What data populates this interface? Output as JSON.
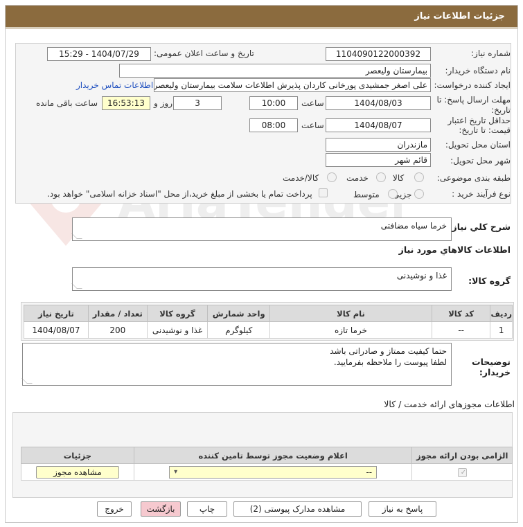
{
  "window": {
    "title": "جزئیات اطلاعات نیاز"
  },
  "info": {
    "need_number_label": "شماره نیاز:",
    "need_number": "1104090122000392",
    "announce_label": "تاریخ و ساعت اعلان عمومی:",
    "announce_value": "1404/07/29 - 15:29",
    "buyer_org_label": "نام دستگاه خریدار:",
    "buyer_org": "بیمارستان ولیعصر",
    "creator_label": "ایجاد کننده درخواست:",
    "creator": "علی اصغر جمشیدی پورخانی کاردان پذیرش اطلاعات سلامت بیمارستان ولیعصر",
    "contact_link": "اطلاعات تماس خریدار",
    "deadline_label_1": "مهلت ارسال پاسخ: تا",
    "deadline_label_2": "تاریخ:",
    "deadline_date": "1404/08/03",
    "time_label": "ساعت",
    "deadline_time": "10:00",
    "days_count": "3",
    "days_and_label": "روز و",
    "remaining_time": "16:53:13",
    "remaining_label": "ساعت باقی مانده",
    "validity_label_1": "حداقل تاریخ اعتبار",
    "validity_label_2": "قیمت: تا تاریخ:",
    "validity_date": "1404/08/07",
    "validity_time": "08:00",
    "province_label": "استان محل تحویل:",
    "province": "مازندران",
    "city_label": "شهر محل تحویل:",
    "city": "قائم شهر",
    "category_label": "طبقه بندی موضوعی:",
    "category_options": [
      "کالا",
      "خدمت",
      "کالا/خدمت"
    ],
    "process_label": "نوع فرآیند خرید :",
    "process_options": [
      "جزیی",
      "متوسط"
    ],
    "payment_note": "پرداخت تمام یا بخشی از مبلغ خرید،از محل \"اسناد خزانه اسلامی\" خواهد بود."
  },
  "description": {
    "label": "شرح كلي نياز:",
    "value": "خرما سیاه مضافتی"
  },
  "goods": {
    "section_title": "اطلاعات كالاهاي مورد نياز",
    "group_label": "گروه کالا:",
    "group_value": "غذا و نوشیدنی",
    "columns": [
      "ردیف",
      "کد کالا",
      "نام کالا",
      "واحد شمارش",
      "گروه کالا",
      "تعداد / مقدار",
      "تاریخ نیاز"
    ],
    "rows": [
      {
        "row": "1",
        "code": "--",
        "name": "خرما تازه",
        "unit": "کیلوگرم",
        "group": "غذا و نوشیدنی",
        "qty": "200",
        "date": "1404/08/07"
      }
    ]
  },
  "buyer_notes": {
    "label_1": "توضیحات",
    "label_2": "خریدار:",
    "line_1": "حتما کیفیت ممتاز و صادراتی باشد",
    "line_2": "لطفا پیوست را ملاحظه بفرمایید."
  },
  "permits": {
    "section_title": "اطلاعات مجوزهای ارائه خدمت / کالا",
    "columns": [
      "الزامی بودن ارائه مجوز",
      "اعلام وضعیت مجوز توسط تامین کننده",
      "جزئیات"
    ],
    "select_value": "--",
    "view_button": "مشاهده مجوز"
  },
  "footer": {
    "reply": "پاسخ به نیاز",
    "attachments": "مشاهده مدارک پیوستی (2)",
    "print": "چاپ",
    "back": "بازگشت",
    "exit": "خروج"
  },
  "watermark_text": "AriaTender.neT",
  "colors": {
    "title_bar": "#8b6b3e",
    "remaining_bg": "#ffffcc",
    "pink_button": "#f6c9cf",
    "link": "#1f4fbf"
  }
}
